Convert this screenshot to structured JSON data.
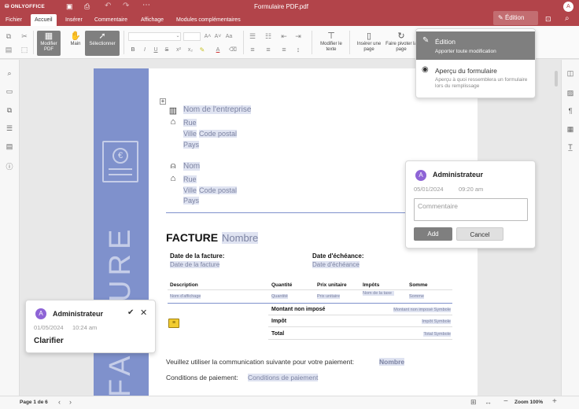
{
  "titlebar": {
    "logo": "ONLYOFFICE",
    "title": "Formulaire PDF.pdf",
    "avatar_initial": "A",
    "icons": [
      "save-icon",
      "print-icon",
      "undo-icon",
      "redo-icon",
      "more-icon"
    ]
  },
  "tabs": [
    "Fichier",
    "Accueil",
    "Insérer",
    "Commentaire",
    "Affichage",
    "Modules complémentaires"
  ],
  "edit_mode": {
    "button_label": "Édition"
  },
  "toolbar": {
    "modify_pdf": "Modifier PDF",
    "hand": "Main",
    "select": "Sélectionner",
    "modify_text": "Modifier le texte",
    "insert_page": "Insérer une page",
    "rotate_page": "Faire pivoter la page"
  },
  "mode_menu": {
    "items": [
      {
        "title": "Édition",
        "desc": "Apporter toute modification"
      },
      {
        "title": "Aperçu du formulaire",
        "desc": "Aperçu à quoi ressemblera un formulaire lors du remplissage"
      }
    ]
  },
  "doc": {
    "vertical_title": "FACTURE",
    "company": "Nom de l'entreprise",
    "street1": "Rue",
    "city1": "Ville",
    "postal1": "Code postal",
    "country1": "Pays",
    "name": "Nom",
    "street2": "Rue",
    "city2": "Ville",
    "postal2": "Code postal",
    "country2": "Pays",
    "invoice_title": "FACTURE",
    "invoice_number": "Nombre",
    "date_label": "Date de la facture:",
    "date_value": "Date de la facture",
    "due_label": "Date d'échéance:",
    "due_value": "Date d'échéance",
    "table": {
      "headers": [
        "Description",
        "Quantité",
        "Prix unitaire",
        "Impôts",
        "Somme"
      ],
      "row": [
        "Nom d'affichage",
        "Quantité",
        "Prix unitaire",
        "Nom de la taxe",
        "Somme"
      ],
      "totals": [
        {
          "label": "Montant non imposé",
          "value": "Montant non imposé Symbole"
        },
        {
          "label": "Impôt",
          "value": "Impôt Symbole"
        },
        {
          "label": "Total",
          "value": "Total Symbole"
        }
      ]
    },
    "payment_text": "Veuillez utiliser la communication suivante pour votre paiement:",
    "payment_value": "Nombre",
    "terms_label": "Conditions de paiement:",
    "terms_value": "Conditions de paiement"
  },
  "comment_new": {
    "author": "Administrateur",
    "initial": "A",
    "date": "05/01/2024",
    "time": "09:20 am",
    "placeholder": "Commentaire",
    "add": "Add",
    "cancel": "Cancel"
  },
  "comment_existing": {
    "author": "Administrateur",
    "initial": "A",
    "date": "01/05/2024",
    "time": "10:24 am",
    "text": "Clarifier"
  },
  "status": {
    "page": "Page 1 de 6",
    "zoom": "Zoom 100%"
  }
}
